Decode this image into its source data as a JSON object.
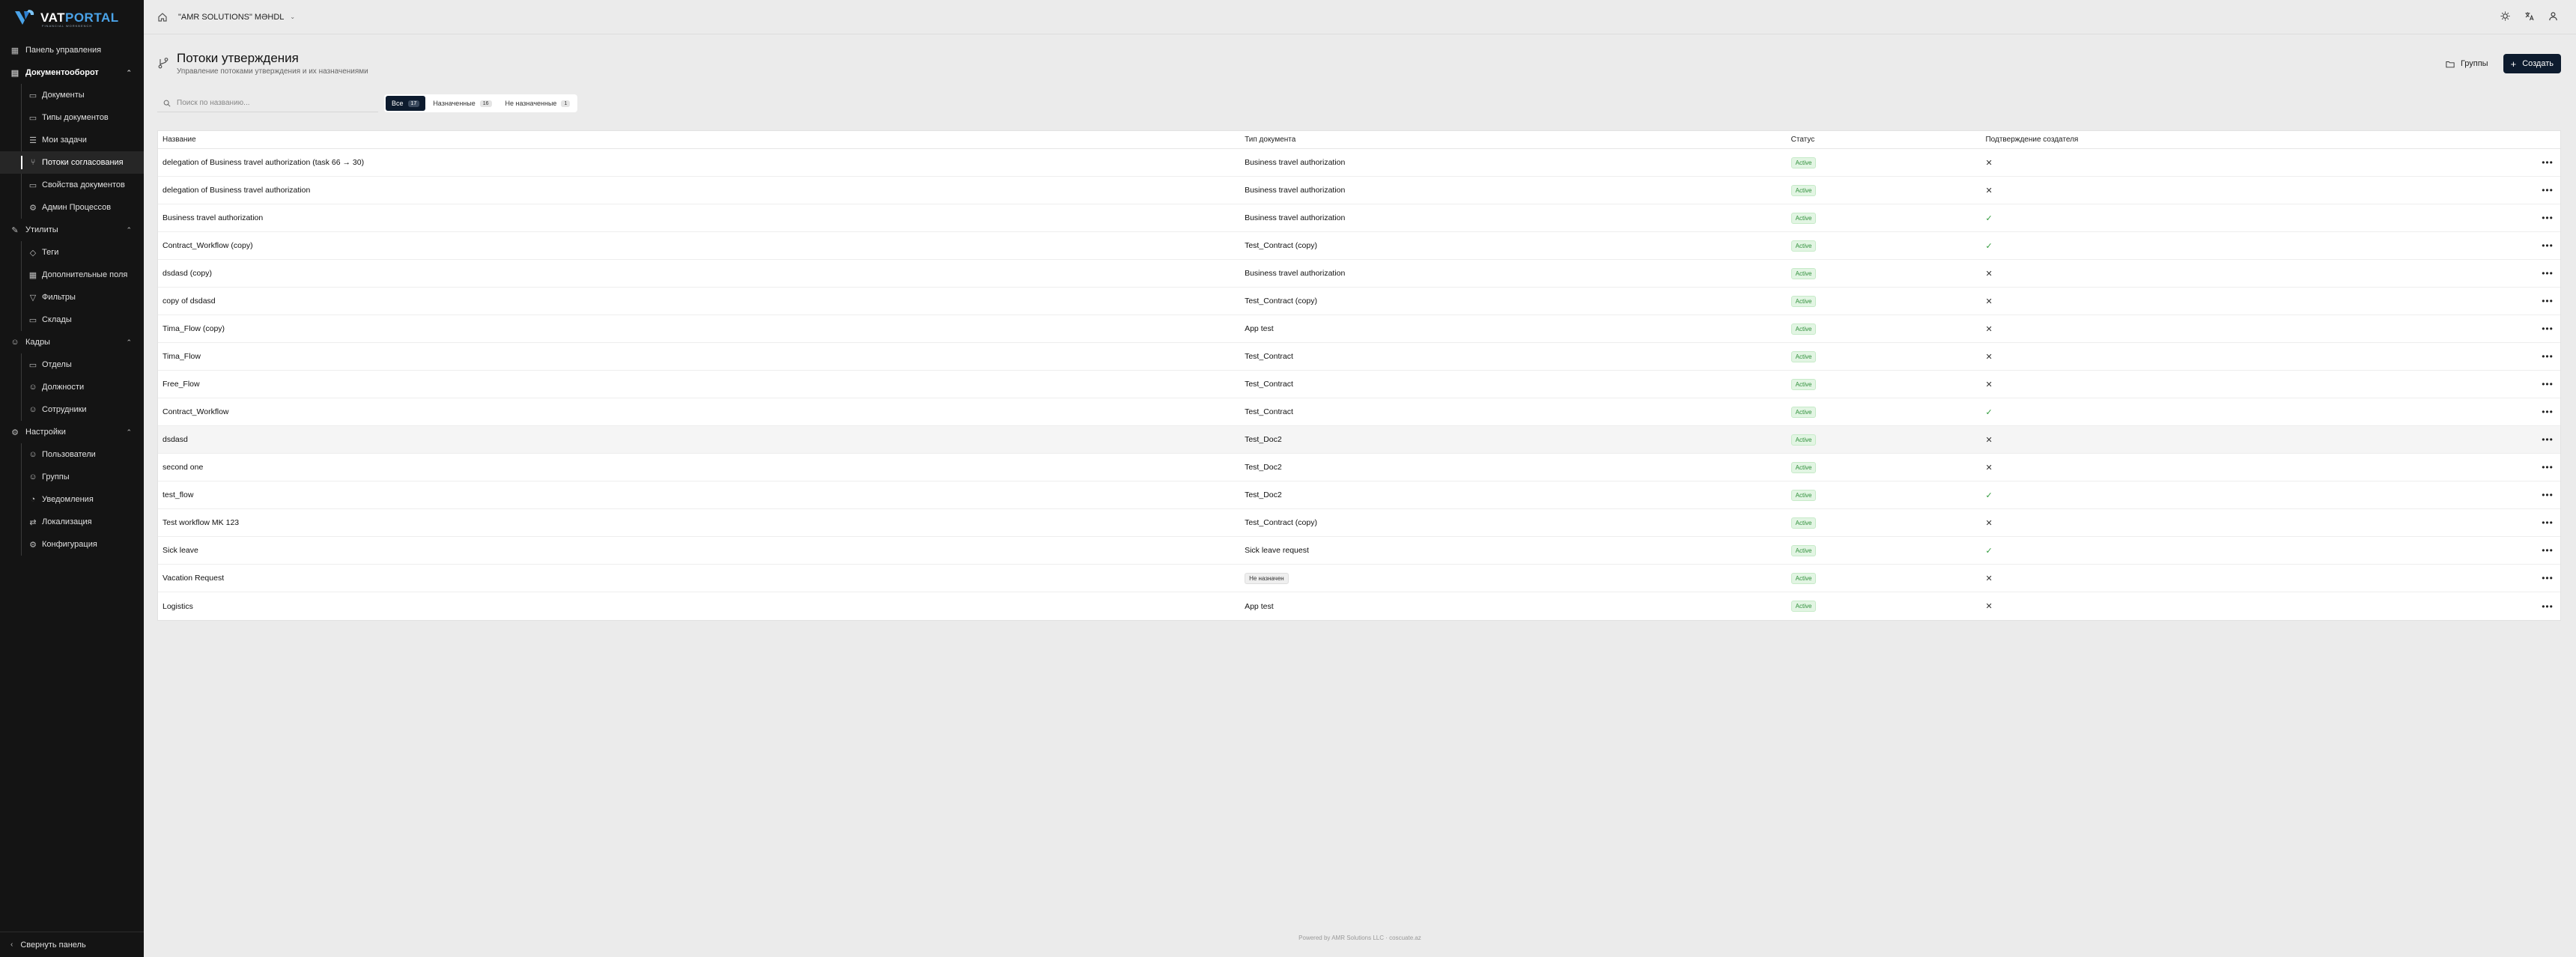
{
  "brand": {
    "name_a": "VAT",
    "name_b": "PORTAL",
    "tagline": "FINANCIAL WORKBENCH"
  },
  "sidebar": {
    "items": [
      {
        "label": "Панель управления",
        "level": "top",
        "icon": "dashboard-icon"
      },
      {
        "label": "Документооборот",
        "level": "top",
        "icon": "document-flow-icon",
        "bold": true,
        "expanded": true
      },
      {
        "label": "Документы",
        "level": "sub",
        "icon": "document-icon"
      },
      {
        "label": "Типы документов",
        "level": "sub",
        "icon": "document-types-icon"
      },
      {
        "label": "Мои задачи",
        "level": "sub",
        "icon": "tasks-icon"
      },
      {
        "label": "Потоки согласования",
        "level": "sub",
        "icon": "workflow-icon",
        "active": true
      },
      {
        "label": "Свойства документов",
        "level": "sub",
        "icon": "properties-icon"
      },
      {
        "label": "Админ Процессов",
        "level": "sub",
        "icon": "admin-icon"
      },
      {
        "label": "Утилиты",
        "level": "top",
        "icon": "tools-icon",
        "expanded": true
      },
      {
        "label": "Теги",
        "level": "sub",
        "icon": "tag-icon"
      },
      {
        "label": "Дополнительные поля",
        "level": "sub",
        "icon": "fields-icon"
      },
      {
        "label": "Фильтры",
        "level": "sub",
        "icon": "filter-icon"
      },
      {
        "label": "Склады",
        "level": "sub",
        "icon": "warehouse-icon"
      },
      {
        "label": "Кадры",
        "level": "top",
        "icon": "people-icon",
        "expanded": true
      },
      {
        "label": "Отделы",
        "level": "sub",
        "icon": "department-icon"
      },
      {
        "label": "Должности",
        "level": "sub",
        "icon": "position-icon"
      },
      {
        "label": "Сотрудники",
        "level": "sub",
        "icon": "employees-icon"
      },
      {
        "label": "Настройки",
        "level": "top",
        "icon": "settings-icon",
        "expanded": true
      },
      {
        "label": "Пользователи",
        "level": "sub",
        "icon": "users-icon"
      },
      {
        "label": "Группы",
        "level": "sub",
        "icon": "groups-icon"
      },
      {
        "label": "Уведомления",
        "level": "sub",
        "icon": "notifications-icon"
      },
      {
        "label": "Локализация",
        "level": "sub",
        "icon": "localization-icon"
      },
      {
        "label": "Конфигурация",
        "level": "sub",
        "icon": "configuration-icon"
      }
    ],
    "collapse_label": "Свернуть панель"
  },
  "topbar": {
    "company": "\"AMR SOLUTIONS\" MƏHDL"
  },
  "header": {
    "title": "Потоки утверждения",
    "subtitle": "Управление потоками утверждения и их назначениями",
    "groups_label": "Группы",
    "create_label": "Создать"
  },
  "filters": {
    "search_placeholder": "Поиск по названию...",
    "tabs": [
      {
        "label": "Все",
        "count": "17",
        "active": true
      },
      {
        "label": "Назначенные",
        "count": "16",
        "active": false
      },
      {
        "label": "Не назначенные",
        "count": "1",
        "active": false
      }
    ]
  },
  "table": {
    "columns": [
      "Название",
      "Тип документа",
      "Статус",
      "Подтверждение создателя"
    ],
    "rows": [
      {
        "name": "delegation of Business travel authorization (task 66 → 30)",
        "type": "Business travel authorization",
        "status": "Active",
        "confirm": false
      },
      {
        "name": "delegation of Business travel authorization",
        "type": "Business travel authorization",
        "status": "Active",
        "confirm": false
      },
      {
        "name": "Business travel authorization",
        "type": "Business travel authorization",
        "status": "Active",
        "confirm": true
      },
      {
        "name": "Contract_Workflow (copy)",
        "type": "Test_Contract (copy)",
        "status": "Active",
        "confirm": true
      },
      {
        "name": "dsdasd (copy)",
        "type": "Business travel authorization",
        "status": "Active",
        "confirm": false
      },
      {
        "name": "copy of dsdasd",
        "type": "Test_Contract (copy)",
        "status": "Active",
        "confirm": false
      },
      {
        "name": "Tima_Flow (copy)",
        "type": "App test",
        "status": "Active",
        "confirm": false
      },
      {
        "name": "Tima_Flow",
        "type": "Test_Contract",
        "status": "Active",
        "confirm": false
      },
      {
        "name": "Free_Flow",
        "type": "Test_Contract",
        "status": "Active",
        "confirm": false
      },
      {
        "name": "Contract_Workflow",
        "type": "Test_Contract",
        "status": "Active",
        "confirm": true
      },
      {
        "name": "dsdasd",
        "type": "Test_Doc2",
        "status": "Active",
        "confirm": false,
        "hover": true
      },
      {
        "name": "second one",
        "type": "Test_Doc2",
        "status": "Active",
        "confirm": false
      },
      {
        "name": "test_flow",
        "type": "Test_Doc2",
        "status": "Active",
        "confirm": true
      },
      {
        "name": "Test workflow MK 123",
        "type": "Test_Contract (copy)",
        "status": "Active",
        "confirm": false
      },
      {
        "name": "Sick leave",
        "type": "Sick leave request",
        "status": "Active",
        "confirm": true
      },
      {
        "name": "Vacation Request",
        "type": "Не назначен",
        "type_badge": true,
        "status": "Active",
        "confirm": false
      },
      {
        "name": "Logistics",
        "type": "App test",
        "status": "Active",
        "confirm": false
      }
    ]
  },
  "footer": {
    "credit": "Powered by AMR Solutions LLC · coscuate.az"
  },
  "colors": {
    "sidebar_bg": "#141414",
    "accent": "#0d1b2e",
    "active_badge": "#2f8f3a",
    "page_bg": "#ebebeb"
  }
}
